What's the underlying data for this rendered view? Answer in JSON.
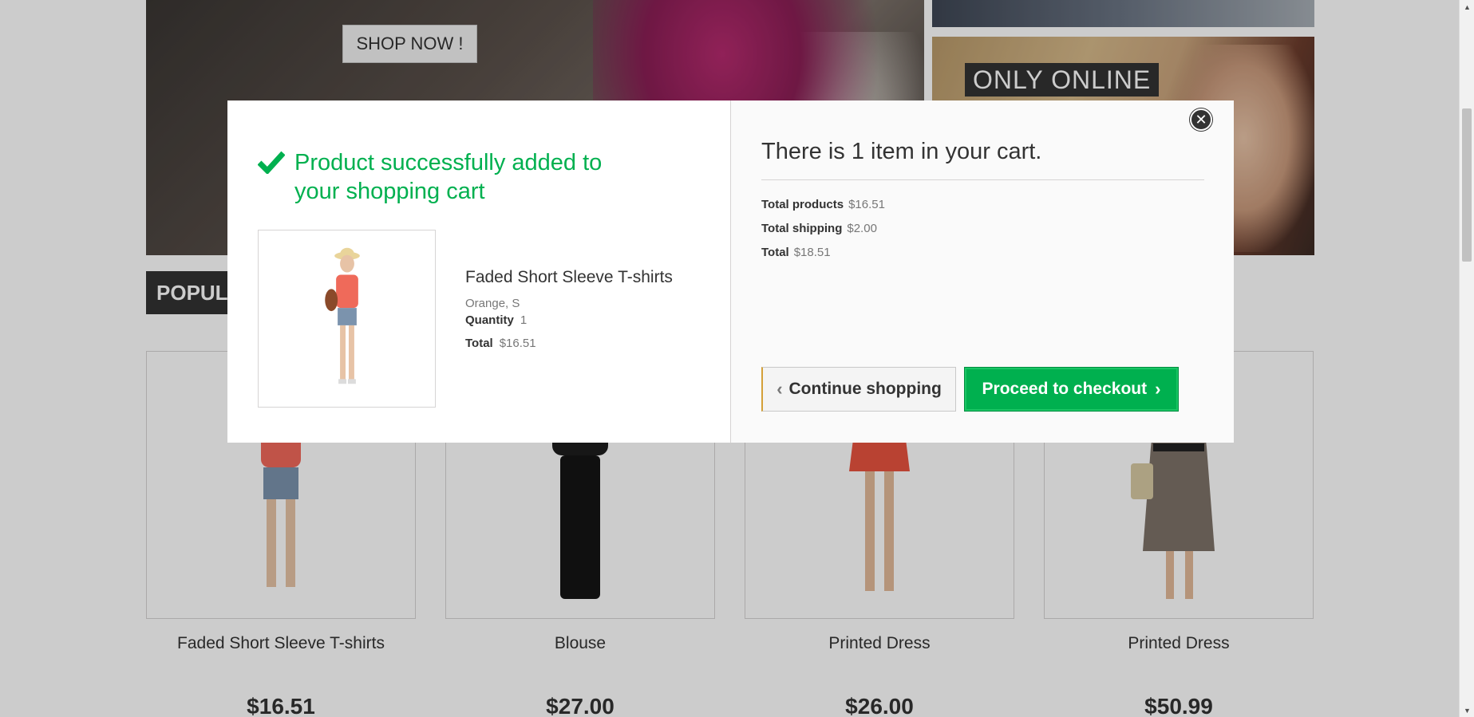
{
  "hero": {
    "shop_now": "SHOP NOW !",
    "only_online": "ONLY ONLINE"
  },
  "popular_tab": "POPULA",
  "products": [
    {
      "name": "Faded Short Sleeve T-shirts",
      "price": "$16.51"
    },
    {
      "name": "Blouse",
      "price": "$27.00"
    },
    {
      "name": "Printed Dress",
      "price": "$26.00"
    },
    {
      "name": "Printed Dress",
      "price": "$50.99"
    }
  ],
  "modal": {
    "success_message": "Product successfully added to your shopping cart",
    "product": {
      "name": "Faded Short Sleeve T-shirts",
      "attributes": "Orange, S",
      "quantity_label": "Quantity",
      "quantity_value": "1",
      "total_label": "Total",
      "total_value": "$16.51"
    },
    "cart_title": "There is 1 item in your cart.",
    "totals": {
      "products_label": "Total products",
      "products_value": "$16.51",
      "shipping_label": "Total shipping",
      "shipping_value": "$2.00",
      "total_label": "Total",
      "total_value": "$18.51"
    },
    "continue_label": "Continue shopping",
    "checkout_label": "Proceed to checkout",
    "close_icon": "close-icon"
  },
  "colors": {
    "success_green": "#00b04f",
    "dark": "#333333",
    "overlay": "rgba(0,0,0,0.2)"
  }
}
